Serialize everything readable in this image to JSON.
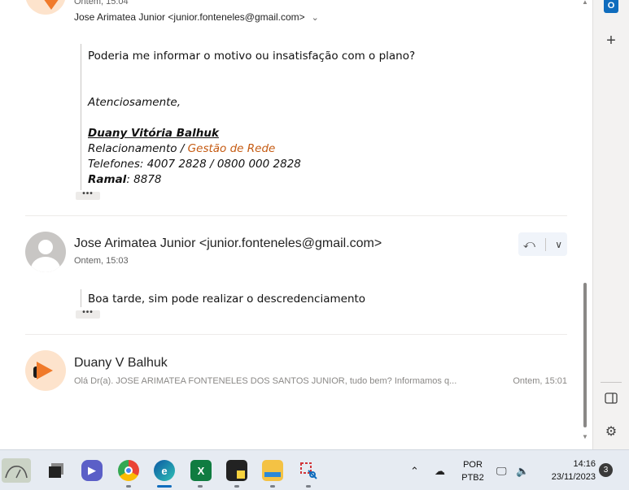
{
  "message_top": {
    "time": "Ontem, 15:04",
    "from": "Jose Arimatea Junior <junior.fonteneles@gmail.com>",
    "body": {
      "line1": "Poderia me informar o motivo ou insatisfação com o plano?",
      "closing": "Atenciosamente,",
      "signature_name": "Duany Vitória Balhuk",
      "role_prefix": "Relacionamento / ",
      "role_dept": "Gestão de Rede",
      "phones": "Telefones: 4007 2828 / 0800 000 2828",
      "ramal_label": "Ramal",
      "ramal_value": ": 8878"
    },
    "more": "•••"
  },
  "message_mid": {
    "sender": "Jose Arimatea Junior <junior.fonteneles@gmail.com>",
    "time": "Ontem, 15:03",
    "body": "Boa tarde, sim pode realizar o descredenciamento",
    "more": "•••",
    "reply_icon": "reply-all-icon",
    "reply_chevron": "chevron-down-icon"
  },
  "message_bottom": {
    "sender": "Duany V Balhuk",
    "preview": "Olá Dr(a). JOSE ARIMATEA FONTENELES DOS SANTOS JUNIOR, tudo bem? Informamos q...",
    "time": "Ontem, 15:01"
  },
  "side_rail": {
    "outlook_letter": "O",
    "add": "+"
  },
  "taskbar": {
    "tray": {
      "lang_top": "POR",
      "lang_bottom": "PTB2",
      "time": "14:16",
      "date": "23/11/2023",
      "notifications": "3"
    }
  },
  "colors": {
    "accent": "#0f6cbd",
    "signature_orange": "#c55a11"
  }
}
